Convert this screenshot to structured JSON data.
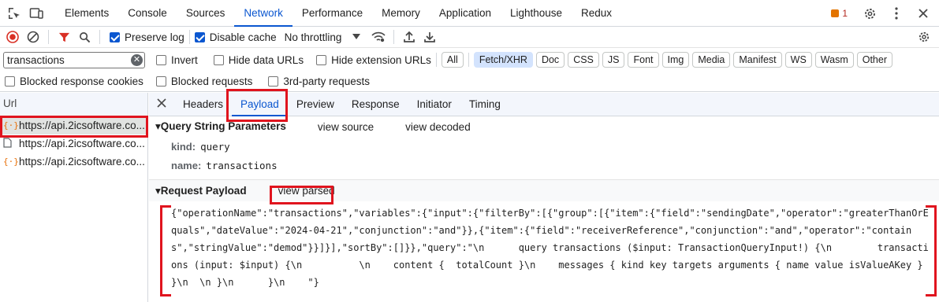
{
  "topbar": {
    "tabs": [
      "Elements",
      "Console",
      "Sources",
      "Network",
      "Performance",
      "Memory",
      "Application",
      "Lighthouse",
      "Redux"
    ],
    "active_tab": "Network",
    "issues_count": "1"
  },
  "toolbar": {
    "preserve_log": "Preserve log",
    "disable_cache": "Disable cache",
    "throttling": "No throttling"
  },
  "filter": {
    "search_value": "transactions",
    "invert": "Invert",
    "hide_data_urls": "Hide data URLs",
    "hide_extension_urls": "Hide extension URLs",
    "types": [
      "All",
      "Fetch/XHR",
      "Doc",
      "CSS",
      "JS",
      "Font",
      "Img",
      "Media",
      "Manifest",
      "WS",
      "Wasm",
      "Other"
    ],
    "selected_type": "Fetch/XHR",
    "blocked_cookies": "Blocked response cookies",
    "blocked_requests": "Blocked requests",
    "third_party": "3rd-party requests"
  },
  "requests": {
    "header": "Url",
    "items": [
      {
        "url": "https://api.2icsoftware.co...",
        "kind": "fetch"
      },
      {
        "url": "https://api.2icsoftware.co...",
        "kind": "doc"
      },
      {
        "url": "https://api.2icsoftware.co...",
        "kind": "fetch"
      }
    ]
  },
  "details": {
    "tabs": [
      "Headers",
      "Payload",
      "Preview",
      "Response",
      "Initiator",
      "Timing"
    ],
    "active_tab": "Payload",
    "query_section": "Query String Parameters",
    "view_source": "view source",
    "view_decoded": "view decoded",
    "params": [
      {
        "key": "kind:",
        "value": "query"
      },
      {
        "key": "name:",
        "value": "transactions"
      }
    ],
    "payload_section": "Request Payload",
    "view_parsed": "view parsed",
    "payload_text": "{\"operationName\":\"transactions\",\"variables\":{\"input\":{\"filterBy\":[{\"group\":[{\"item\":{\"field\":\"sendingDate\",\"operator\":\"greaterThanOrEquals\",\"dateValue\":\"2024-04-21\",\"conjunction\":\"and\"}},{\"item\":{\"field\":\"receiverReference\",\"conjunction\":\"and\",\"operator\":\"contains\",\"stringValue\":\"demod\"}}]}],\"sortBy\":[]}},\"query\":\"\\n      query transactions ($input: TransactionQueryInput!) {\\n        transactions (input: $input) {\\n          \\n    content {  totalCount }\\n    messages { kind key targets arguments { name value isValueAKey } }\\n  \\n }\\n      }\\n    \"}"
  },
  "colors": {
    "accent": "#0b57d0",
    "highlight_box": "#e0141e",
    "record_red": "#d93025"
  }
}
